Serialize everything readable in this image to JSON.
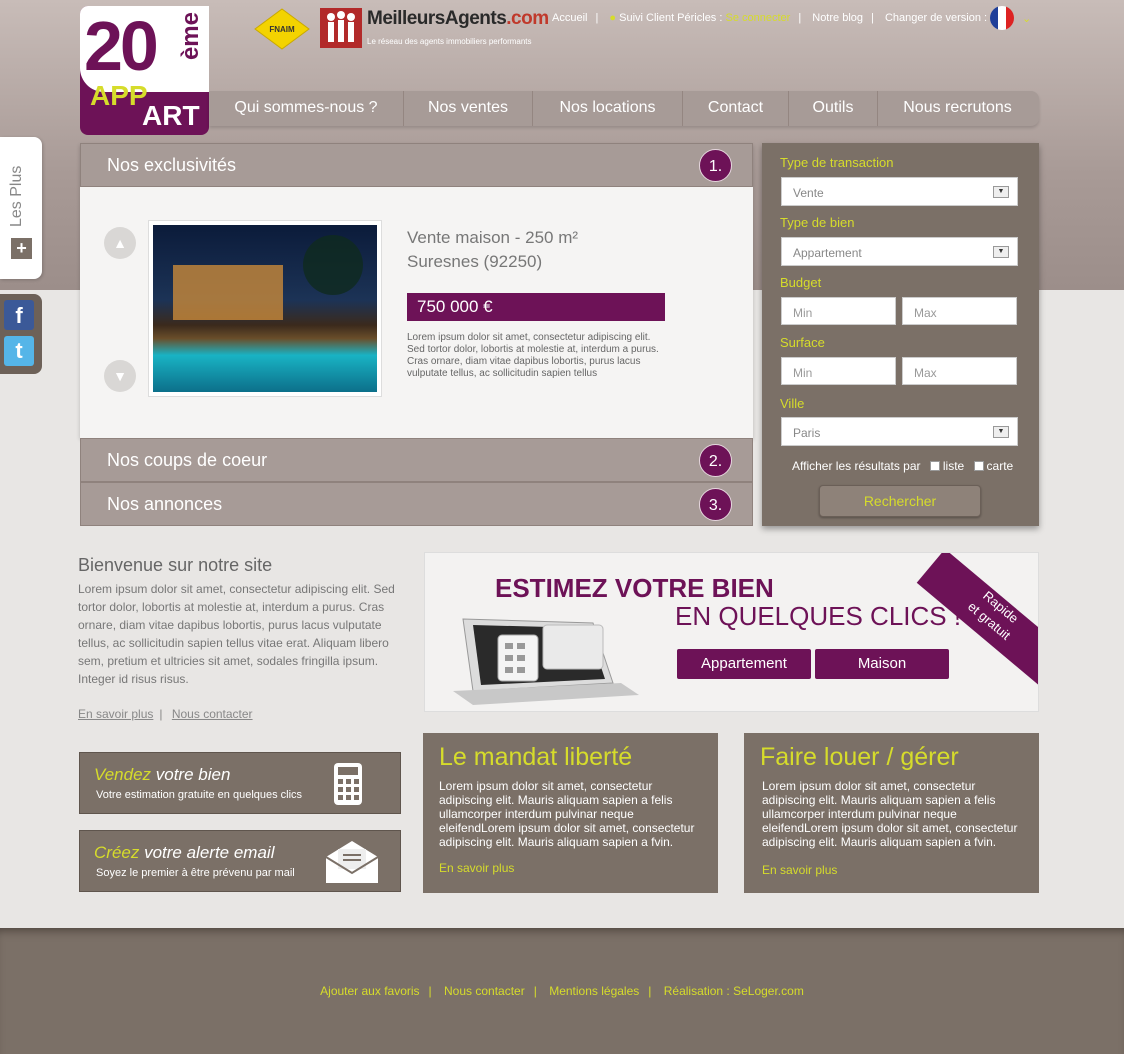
{
  "header": {
    "logo": {
      "n20": "20",
      "eme": "ème",
      "app": "APP",
      "art": "ART"
    },
    "partners": {
      "fnaim": "FNAIM",
      "ma_name": "MeilleursAgents",
      "ma_com": ".com",
      "ma_sub": "Le réseau des agents immobiliers performants"
    },
    "top_links": {
      "accueil": "Accueil",
      "suivi": "Suivi Client Péricles :",
      "connect": "Se connecter",
      "blog": "Notre blog",
      "version": "Changer de version :"
    },
    "nav": [
      "Qui sommes-nous ?",
      "Nos ventes",
      "Nos locations",
      "Contact",
      "Outils",
      "Nous recrutons"
    ]
  },
  "sidebar": {
    "les_plus": "Les Plus",
    "plus_icon": "+"
  },
  "social": {
    "facebook": "f",
    "twitter": "t"
  },
  "accordion": [
    {
      "title": "Nos exclusivités",
      "num": "1."
    },
    {
      "title": "Nos coups de coeur",
      "num": "2."
    },
    {
      "title": "Nos annonces",
      "num": "3."
    }
  ],
  "listing": {
    "title1": "Vente maison - 250 m²",
    "title2": "Suresnes (92250)",
    "price": "750 000 €",
    "desc": "Lorem ipsum dolor sit amet, consectetur adipiscing elit. Sed tortor dolor, lobortis at molestie at, interdum a purus. Cras ornare, diam vitae dapibus lobortis, purus lacus vulputate tellus, ac sollicitudin sapien tellus"
  },
  "search": {
    "transaction_label": "Type de transaction",
    "transaction_value": "Vente",
    "bien_label": "Type de bien",
    "bien_value": "Appartement",
    "budget_label": "Budget",
    "surface_label": "Surface",
    "min": "Min",
    "max": "Max",
    "ville_label": "Ville",
    "ville_value": "Paris",
    "afficher": "Afficher les résultats par",
    "liste": "liste",
    "carte": "carte",
    "button": "Rechercher"
  },
  "welcome": {
    "title": "Bienvenue sur notre site",
    "text": "Lorem ipsum dolor sit amet, consectetur adipiscing elit. Sed tortor dolor, lobortis at molestie at, interdum a purus. Cras ornare, diam vitae dapibus lobortis, purus lacus vulputate tellus, ac sollicitudin sapien tellus vitae erat. Aliquam libero sem, pretium et ultricies sit amet, sodales fringilla ipsum. Integer id risus risus.",
    "more": "En savoir plus",
    "contact": "Nous contacter"
  },
  "estimate": {
    "title1": "ESTIMEZ VOTRE BIEN",
    "title2": "EN QUELQUES CLICS !",
    "btn1": "Appartement",
    "btn2": "Maison",
    "ribbon1": "Rapide",
    "ribbon2": "et gratuit"
  },
  "sell_box": {
    "y": "Vendez",
    "w": " votre bien",
    "sub": "Votre estimation gratuite en quelques clics"
  },
  "alert_box": {
    "y": "Créez",
    "w": " votre alerte email",
    "sub": "Soyez le premier à être prévenu par mail"
  },
  "mandat": {
    "title": "Le mandat liberté",
    "text": "Lorem ipsum dolor sit amet, consectetur adipiscing elit. Mauris aliquam sapien a felis ullamcorper interdum pulvinar neque eleifendLorem ipsum dolor sit amet, consectetur adipiscing elit. Mauris aliquam sapien a fvin.",
    "link": "En savoir plus"
  },
  "louer": {
    "title": "Faire louer / gérer",
    "text": "Lorem ipsum dolor sit amet, consectetur adipiscing elit. Mauris aliquam sapien a felis ullamcorper interdum pulvinar neque eleifendLorem ipsum dolor sit amet, consectetur adipiscing elit. Mauris aliquam sapien a fvin.",
    "link": "En savoir plus"
  },
  "footer": [
    "Ajouter aux favoris",
    "Nous contacter",
    "Mentions légales",
    "Réalisation : SeLoger.com"
  ]
}
